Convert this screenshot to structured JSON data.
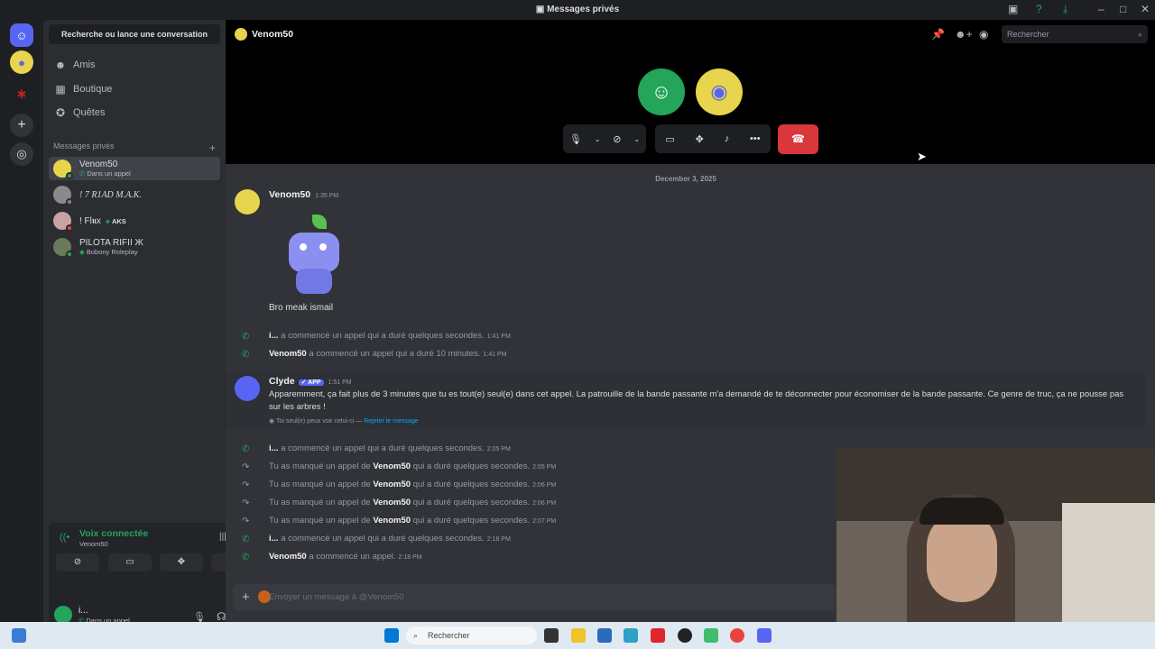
{
  "window": {
    "title": "Messages privés"
  },
  "sidebar": {
    "search_label": "Recherche ou lance une conversation",
    "nav": [
      {
        "label": "Amis",
        "icon": "friends-icon"
      },
      {
        "label": "Boutique",
        "icon": "shop-icon"
      },
      {
        "label": "Quêtes",
        "icon": "quests-icon"
      }
    ],
    "dm_header": "Messages privés",
    "dms": [
      {
        "name": "Venom50",
        "status": "Dans un appel",
        "color": "#7a79d9"
      },
      {
        "name": "! 7 R1AD M.A.K.",
        "status": "",
        "color": "#8a8a8a"
      },
      {
        "name": "! Fl𝖚x",
        "status": "AKS",
        "color": "#c9a2a2"
      },
      {
        "name": "PILOTA RIFII Ж",
        "status": "Bobony Roleplay",
        "color": "#6a7a5a"
      }
    ]
  },
  "voice": {
    "status": "Voix connectée",
    "channel": "Venom50",
    "user_name": "i...",
    "user_status": "Dans un appel"
  },
  "header": {
    "dm_name": "Venom50",
    "search_placeholder": "Rechercher"
  },
  "date_divider": "December 3, 2025",
  "messages": {
    "m1": {
      "author": "Venom50",
      "time": "1:35 PM",
      "text": "Bro meak ismail"
    },
    "sys1": {
      "author": "i...",
      "text": "a commencé un appel qui a duré quelques secondes.",
      "time": "1:41 PM"
    },
    "sys2": {
      "author": "Venom50",
      "text": "a commencé un appel qui a duré 10 minutes.",
      "time": "1:41 PM"
    },
    "clyde": {
      "author": "Clyde",
      "badge": "APP",
      "time": "1:51 PM",
      "text": "Apparemment, ça fait plus de 3 minutes que tu es tout(e) seul(e) dans cet appel. La patrouille de la bande passante m'a demandé de te déconnecter pour économiser de la bande passante. Ce genre de truc, ça ne pousse pas sur les arbres !",
      "note": "Toi seul(e) peux voir celui-ci —",
      "dismiss": "Rejeter le message"
    },
    "sys3": {
      "author": "i...",
      "text": "a commencé un appel qui a duré quelques secondes.",
      "time": "2:05 PM"
    },
    "missed1": {
      "pre": "Tu as manqué un appel de",
      "author": "Venom50",
      "post": "qui a duré quelques secondes.",
      "time": "2:05 PM"
    },
    "missed2": {
      "pre": "Tu as manqué un appel de",
      "author": "Venom50",
      "post": "qui a duré quelques secondes.",
      "time": "2:06 PM"
    },
    "missed3": {
      "pre": "Tu as manqué un appel de",
      "author": "Venom50",
      "post": "qui a duré quelques secondes.",
      "time": "2:06 PM"
    },
    "missed4": {
      "pre": "Tu as manqué un appel de",
      "author": "Venom50",
      "post": "qui a duré quelques secondes.",
      "time": "2:07 PM"
    },
    "sys4": {
      "author": "i...",
      "text": "a commencé un appel qui a duré quelques secondes.",
      "time": "2:18 PM"
    },
    "sys5": {
      "author": "Venom50",
      "text": "a commencé un appel.",
      "time": "2:18 PM"
    }
  },
  "input": {
    "placeholder": "Envoyer un message à @Venom50"
  },
  "taskbar": {
    "search": "Rechercher"
  },
  "colors": {
    "discord": "#5865f2",
    "hangup": "#da373c",
    "connected": "#23a55a"
  }
}
